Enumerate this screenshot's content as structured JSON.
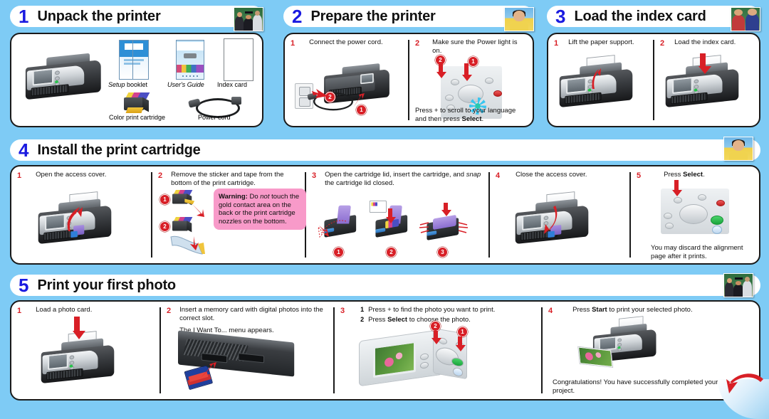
{
  "theme": {
    "background": "#7ecbf5",
    "header_bar": "#ffffff",
    "number_color": "#1a1ae0",
    "step_number_color": "#d81f26",
    "warning_bg": "#f89ac9",
    "arrow_color": "#d81f26"
  },
  "sections": [
    {
      "number": "1",
      "title": "Unpack the printer",
      "thumbnail": "graduation-photo",
      "steps": [],
      "labels": {
        "printer": "",
        "setup_booklet": "Setup booklet",
        "setup_booklet_italic": "Setup",
        "setup_booklet_rest": " booklet",
        "users_guide": "User's Guide",
        "index_card": "Index card",
        "color_print_cartridge": "Color print cartridge",
        "power_cord": "Power cord"
      }
    },
    {
      "number": "2",
      "title": "Prepare the printer",
      "thumbnail": "kid-with-cake-photo",
      "steps": [
        {
          "num": "1",
          "text": "Connect the power cord.",
          "callouts": [
            "1",
            "2"
          ]
        },
        {
          "num": "2",
          "text": "Make sure the Power light is on.",
          "footer_pre": "Press + to scroll to your language and then press ",
          "footer_bold": "Select",
          "footer_post": ".",
          "callouts": [
            "1",
            "2"
          ]
        }
      ]
    },
    {
      "number": "3",
      "title": "Load the index card",
      "thumbnail": "two-kids-photo",
      "steps": [
        {
          "num": "1",
          "text": "Lift the paper support."
        },
        {
          "num": "2",
          "text": "Load the index card."
        }
      ]
    },
    {
      "number": "4",
      "title": "Install the print cartridge",
      "thumbnail": "kid-with-cake-photo",
      "steps": [
        {
          "num": "1",
          "text": "Open the access cover."
        },
        {
          "num": "2",
          "text": "Remove the sticker and tape from the bottom of the print cartridge.",
          "callouts": [
            "1",
            "2"
          ],
          "warning": {
            "label": "Warning:",
            "pre": " Do ",
            "italic": "not",
            "post": " touch the gold contact area on the back or the print cartridge nozzles on the bottom."
          }
        },
        {
          "num": "3",
          "text_pre": "Open the cartridge lid, insert the cartridge, and ",
          "text_italic": "snap",
          "text_post": " the cartridge lid closed.",
          "callouts": [
            "1",
            "2",
            "3"
          ]
        },
        {
          "num": "4",
          "text": "Close the access cover."
        },
        {
          "num": "5",
          "text_pre": "Press ",
          "text_bold": "Select",
          "text_post": ".",
          "footer": "You may discard the alignment page after it prints."
        }
      ]
    },
    {
      "number": "5",
      "title": "Print your first photo",
      "thumbnail": "graduation-photo",
      "steps": [
        {
          "num": "1",
          "text": "Load a photo card."
        },
        {
          "num": "2",
          "text": "Insert a memory card with digital photos into the correct slot.",
          "text2": "The I Want To... menu appears."
        },
        {
          "num": "3",
          "substeps": [
            {
              "n": "1",
              "pre": "Press + to find the photo you want to print.",
              "bold": "",
              "post": ""
            },
            {
              "n": "2",
              "pre": "Press ",
              "bold": "Select",
              "post": " to choose the photo."
            }
          ],
          "callouts": [
            "1",
            "2"
          ]
        },
        {
          "num": "4",
          "text_pre": "Press ",
          "text_bold": "Start",
          "text_post": " to print your selected photo.",
          "footer": "Congratulations! You have successfully completed your first project."
        }
      ]
    }
  ]
}
